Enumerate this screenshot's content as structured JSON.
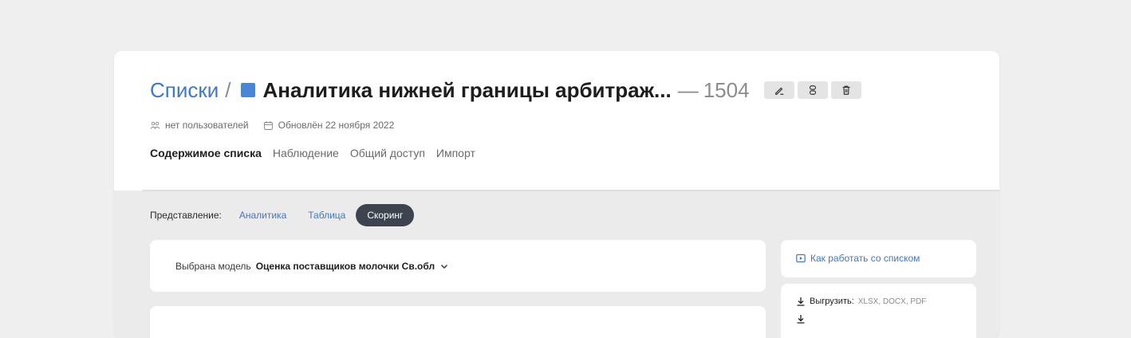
{
  "header": {
    "breadcrumb_link": "Списки",
    "breadcrumb_separator": "/",
    "list_name": "Аналитика нижней границы арбитраж...",
    "count_separator": "—",
    "count": "1504",
    "list_color": "#4a86d6",
    "actions": [
      {
        "icon": "edit-icon"
      },
      {
        "icon": "link-icon"
      },
      {
        "icon": "trash-icon"
      }
    ]
  },
  "meta": {
    "users": "нет пользователей",
    "updated": "Обновлён 22 ноября 2022"
  },
  "tabs": [
    {
      "label": "Содержимое списка",
      "active": true
    },
    {
      "label": "Наблюдение",
      "active": false
    },
    {
      "label": "Общий доступ",
      "active": false
    },
    {
      "label": "Импорт",
      "active": false
    }
  ],
  "view": {
    "label": "Представление:",
    "options": [
      "Аналитика",
      "Таблица"
    ],
    "selected": "Скоринг"
  },
  "model": {
    "label": "Выбрана модель",
    "value": "Оценка поставщиков молочки Св.обл"
  },
  "sidebar": {
    "help_link": "Как работать со списком",
    "export_label": "Выгрузить:",
    "export_formats": [
      "XLSX",
      "DOCX",
      "PDF"
    ],
    "second_action": ""
  },
  "colors": {
    "accent": "#3f78c4",
    "pill_bg": "#3d4450",
    "page_bg": "#efefef"
  }
}
